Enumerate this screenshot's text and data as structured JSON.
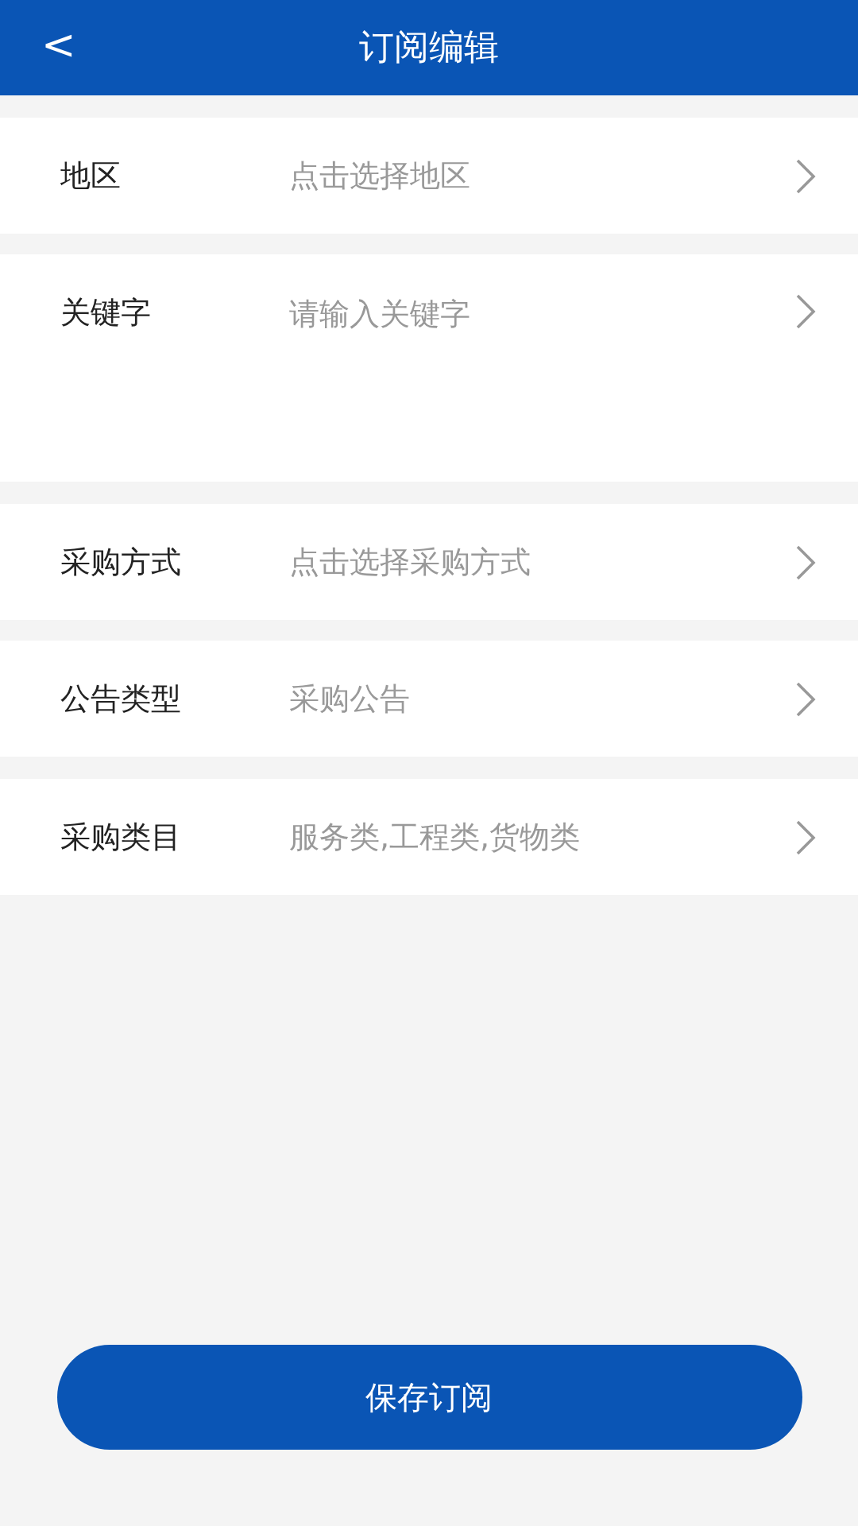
{
  "header": {
    "back": "<",
    "title": "订阅编辑"
  },
  "rows": [
    {
      "kind": "select",
      "label": "地区",
      "placeholder": "点击选择地区"
    },
    {
      "kind": "textarea",
      "label": "关键字",
      "placeholder": "请输入关键字"
    },
    {
      "kind": "select",
      "label": "采购方式",
      "placeholder": "点击选择采购方式"
    },
    {
      "kind": "select",
      "label": "公告类型",
      "value": "采购公告"
    },
    {
      "kind": "select",
      "label": "采购类目",
      "value": "服务类,工程类,货物类"
    }
  ],
  "save_button": "保存订阅"
}
